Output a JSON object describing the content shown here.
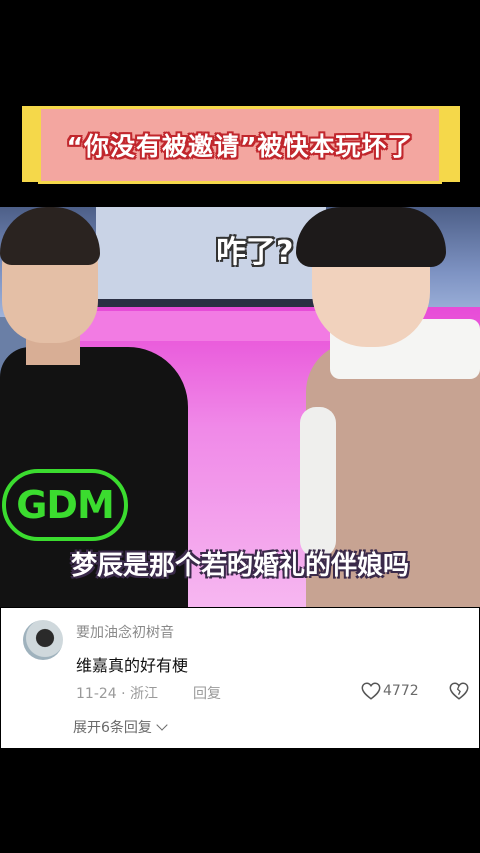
{
  "title_banner": {
    "text": "“你没有被邀请”被快本玩坏了",
    "bg_color": "#f3a6a0",
    "border_color": "#f5d84a",
    "text_outline": "#c1272d"
  },
  "video": {
    "caption_top": "咋了?",
    "subtitle": "梦辰是那个若昀婚礼的伴娘吗",
    "shirt_logo": "GDM"
  },
  "comment": {
    "username": "要加油念初树音",
    "text": "维嘉真的好有梗",
    "date": "11-24",
    "location": "浙江",
    "reply_label": "回复",
    "like_count": "4772",
    "expand_label": "展开6条回复",
    "icons": {
      "avatar": "avatar",
      "like": "heart-outline-icon",
      "dislike": "broken-heart-icon",
      "expand": "chevron-down-icon"
    }
  }
}
